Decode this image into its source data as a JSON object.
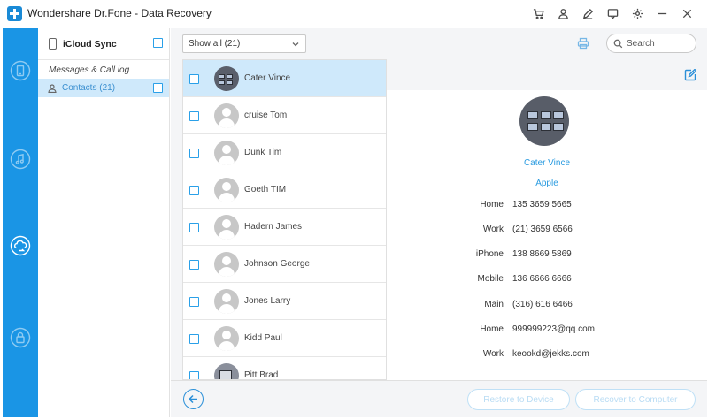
{
  "window": {
    "title": "Wondershare Dr.Fone - Data Recovery",
    "titlebar_icons": [
      "cart-icon",
      "user-icon",
      "pen-icon",
      "feedback-icon",
      "gear-icon",
      "minimize-icon",
      "close-icon"
    ]
  },
  "rail": {
    "items": [
      {
        "icon": "device-recovery-icon",
        "active": false
      },
      {
        "icon": "itunes-music-icon",
        "active": false
      },
      {
        "icon": "icloud-sync-icon",
        "active": true
      },
      {
        "icon": "lock-icon",
        "active": false
      }
    ]
  },
  "categories": {
    "header": "iCloud Sync",
    "group": "Messages & Call log",
    "item": "Contacts (21)"
  },
  "toolbar": {
    "filter_value": "Show all (21)",
    "search_placeholder": "Search"
  },
  "contacts": [
    {
      "name": "Cater Vince",
      "photo": true,
      "selected": true
    },
    {
      "name": "cruise Tom",
      "photo": false,
      "selected": false
    },
    {
      "name": "Dunk Tim",
      "photo": false,
      "selected": false
    },
    {
      "name": "Goeth TIM",
      "photo": false,
      "selected": false
    },
    {
      "name": "Hadern James",
      "photo": false,
      "selected": false
    },
    {
      "name": "Johnson George",
      "photo": false,
      "selected": false
    },
    {
      "name": "Jones Larry",
      "photo": false,
      "selected": false
    },
    {
      "name": "Kidd Paul",
      "photo": false,
      "selected": false
    },
    {
      "name": "Pitt Brad",
      "photo": true,
      "selected": false
    }
  ],
  "detail": {
    "name": "Cater Vince",
    "company": "Apple",
    "fields": [
      {
        "label": "Home",
        "value": "135 3659 5665"
      },
      {
        "label": "Work",
        "value": "(21) 3659 6566"
      },
      {
        "label": "iPhone",
        "value": "138 8669 5869"
      },
      {
        "label": "Mobile",
        "value": "136 6666 6666"
      },
      {
        "label": "Main",
        "value": "(316) 616 6466"
      },
      {
        "label": "Home",
        "value": "999999223@qq.com"
      },
      {
        "label": "Work",
        "value": "keookd@jekks.com"
      }
    ]
  },
  "buttons": {
    "restore": "Restore to Device",
    "recover": "Recover to Computer"
  },
  "colors": {
    "accent": "#1a95e5",
    "selection": "#cfe9fb",
    "link": "#2a9be0"
  }
}
